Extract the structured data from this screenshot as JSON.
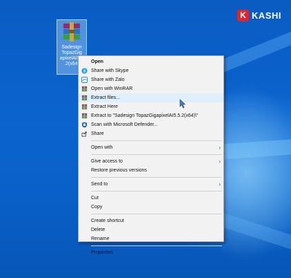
{
  "brand": {
    "logo_letter": "K",
    "logo_text": "KASHI",
    "accent": "#d9272d"
  },
  "desktop_icon": {
    "label": "Sadesign\nTopazGig\napixelAI5.5\n.2(x64)"
  },
  "context_menu": {
    "items": [
      {
        "label": "Open",
        "icon": "none",
        "bold": true
      },
      {
        "label": "Share with Skype",
        "icon": "skype-icon"
      },
      {
        "label": "Share with Zalo",
        "icon": "zalo-icon"
      },
      {
        "label": "Open with WinRAR",
        "icon": "winrar-icon"
      },
      {
        "label": "Extract files...",
        "icon": "winrar-icon",
        "hover": true
      },
      {
        "label": "Extract Here",
        "icon": "winrar-icon"
      },
      {
        "label": "Extract to \"Sadesign TopazGigapixelAI5.5.2(x64)\\\"",
        "icon": "winrar-icon"
      },
      {
        "label": "Scan with Microsoft Defender...",
        "icon": "defender-icon"
      },
      {
        "label": "Share",
        "icon": "share-icon"
      },
      {
        "label": "Open with",
        "icon": "none",
        "submenu": true
      },
      {
        "label": "Give access to",
        "icon": "none",
        "submenu": true
      },
      {
        "label": "Restore previous versions",
        "icon": "none"
      },
      {
        "label": "Send to",
        "icon": "none",
        "submenu": true
      },
      {
        "label": "Cut",
        "icon": "none"
      },
      {
        "label": "Copy",
        "icon": "none"
      },
      {
        "label": "Create shortcut",
        "icon": "none"
      },
      {
        "label": "Delete",
        "icon": "none"
      },
      {
        "label": "Rename",
        "icon": "none"
      },
      {
        "label": "Properties",
        "icon": "none"
      }
    ]
  }
}
